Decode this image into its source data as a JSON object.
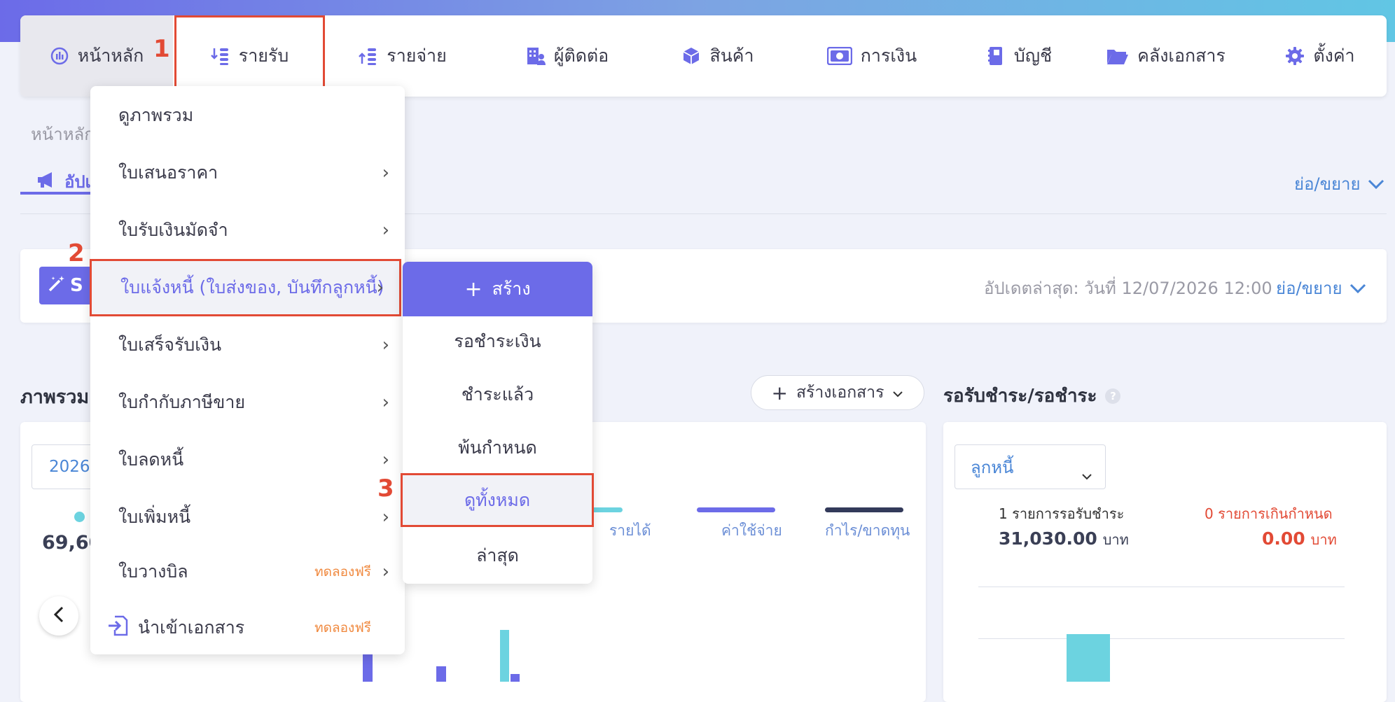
{
  "colors": {
    "accent": "#6c6be8",
    "highlight": "#e24a35",
    "link": "#4a86d6",
    "trial": "#f08a40",
    "cyan": "#6cd3e0",
    "dark": "#333a5a"
  },
  "nav": [
    {
      "label": "หน้าหลัก",
      "icon": "dashboard-icon"
    },
    {
      "label": "รายรับ",
      "icon": "income-icon"
    },
    {
      "label": "รายจ่าย",
      "icon": "expense-icon"
    },
    {
      "label": "ผู้ติดต่อ",
      "icon": "contacts-icon"
    },
    {
      "label": "สินค้า",
      "icon": "box-icon"
    },
    {
      "label": "การเงิน",
      "icon": "money-icon"
    },
    {
      "label": "บัญชี",
      "icon": "book-icon"
    },
    {
      "label": "คลังเอกสาร",
      "icon": "folder-icon"
    },
    {
      "label": "ตั้งค่า",
      "icon": "gear-icon"
    }
  ],
  "steps": [
    "1",
    "2",
    "3"
  ],
  "page": {
    "breadcrumb": "หน้าหลัก",
    "tab_label": "อัปเ",
    "collapse_label": "ย่อ/ขยาย",
    "wizard_btn": "S",
    "last_updated": "อัปเดตล่าสุด: วันที่ 12/07/2026 12:00",
    "collapse_label2": "ย่อ/ขยาย",
    "overview_title": "ภาพรวม",
    "create_doc_label": "สร้างเอกสาร",
    "year_value": "2026",
    "big_value": "69,60",
    "legend": [
      "รายได้",
      "ค่าใช้จ่าย",
      "กำไร/ขาดทุน"
    ],
    "receivable_title": "รอรับชำระ/รอชำระ",
    "debtor_select": "ลูกหนี้",
    "pending_count": "1 รายการรอรับชำระ",
    "pending_amount": "31,030.00",
    "overdue_count": "0 รายการเกินกำหนด",
    "overdue_amount": "0.00",
    "currency": "บาท"
  },
  "menu": [
    {
      "label": "ดูภาพรวม",
      "chevron": ""
    },
    {
      "label": "ใบเสนอราคา",
      "chevron": "›"
    },
    {
      "label": "ใบรับเงินมัดจำ",
      "chevron": "›"
    },
    {
      "label": "ใบแจ้งหนี้ (ใบส่งของ, บันทึกลูกหนี้)",
      "chevron": "›"
    },
    {
      "label": "ใบเสร็จรับเงิน",
      "chevron": "›"
    },
    {
      "label": "ใบกำกับภาษีขาย",
      "chevron": "›"
    },
    {
      "label": "ใบลดหนี้",
      "chevron": "›"
    },
    {
      "label": "ใบเพิ่มหนี้",
      "chevron": "›"
    },
    {
      "label": "ใบวางบิล",
      "chevron": "›",
      "badge": "ทดลองฟรี"
    },
    {
      "label": "นำเข้าเอกสาร",
      "badge": "ทดลองฟรี"
    }
  ],
  "submenu": {
    "create": "สร้าง",
    "items": [
      "รอชำระเงิน",
      "ชำระแล้ว",
      "พ้นกำหนด",
      "ดูทั้งหมด",
      "ล่าสุด"
    ]
  }
}
